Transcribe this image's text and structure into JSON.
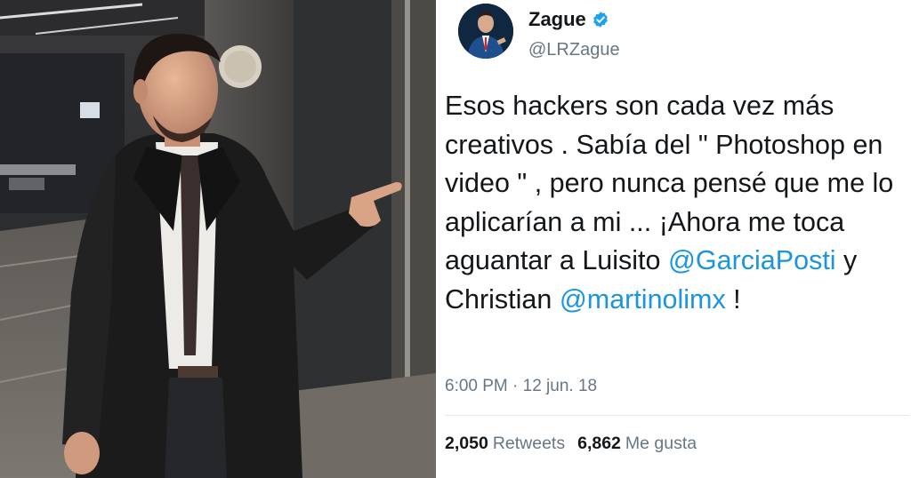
{
  "tweet": {
    "display_name": "Zague",
    "handle": "@LRZague",
    "text": {
      "part1": "Esos hackers son cada vez más creativos . Sabía del \" Photoshop en video \" , pero nunca pensé que me lo aplicarían a mi ... ¡Ahora me toca aguantar a Luisito ",
      "mention1": "@GarciaPosti",
      "part2": " y Christian ",
      "mention2": "@martinolimx",
      "part3": " !"
    },
    "timestamp": "6:00 PM · 12 jun. 18",
    "retweets_count": "2,050",
    "retweets_label": "Retweets",
    "likes_count": "6,862",
    "likes_label": "Me gusta"
  },
  "colors": {
    "link": "#1b95e0",
    "secondary_text": "#657786",
    "primary_text": "#14171a",
    "verified": "#1da1f2"
  },
  "icons": {
    "verified": "verified-badge-icon"
  }
}
